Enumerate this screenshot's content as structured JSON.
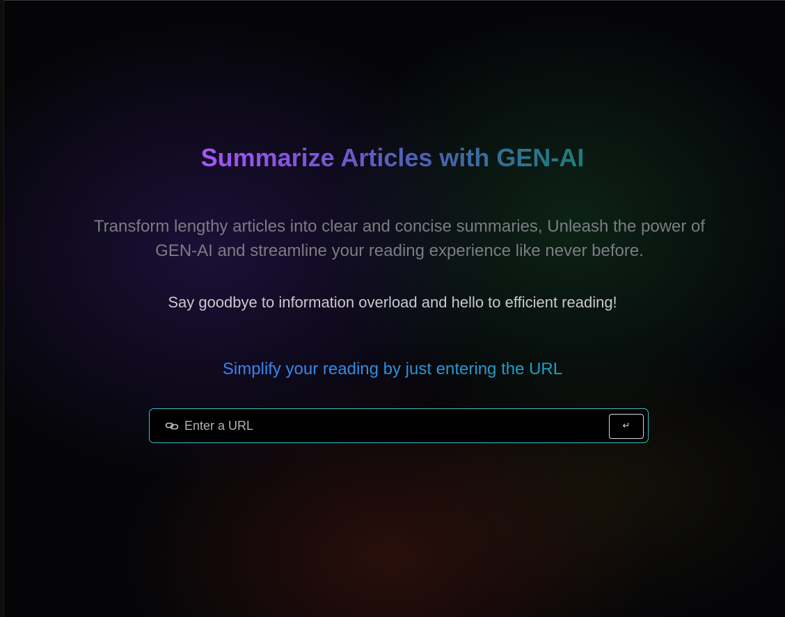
{
  "hero": {
    "title": "Summarize Articles with GEN-AI",
    "description": "Transform lengthy articles into clear and concise summaries, Unleash the power of GEN-AI and streamline your reading experience like never before.",
    "tagline": "Say goodbye to information overload and hello to efficient reading!",
    "prompt": "Simplify your reading by just entering the URL"
  },
  "url_form": {
    "icon": "link-icon",
    "value": "",
    "placeholder": "Enter a URL",
    "submit_icon": "return-arrow-icon",
    "submit_glyph": "↵"
  },
  "colors": {
    "title_gradient": [
      "#a855f7",
      "#4a62b0",
      "#1a7e7a"
    ],
    "prompt_gradient": [
      "#3b82f6",
      "#1aa3c4"
    ],
    "input_border": "#34c3c0",
    "background": "#050508"
  }
}
